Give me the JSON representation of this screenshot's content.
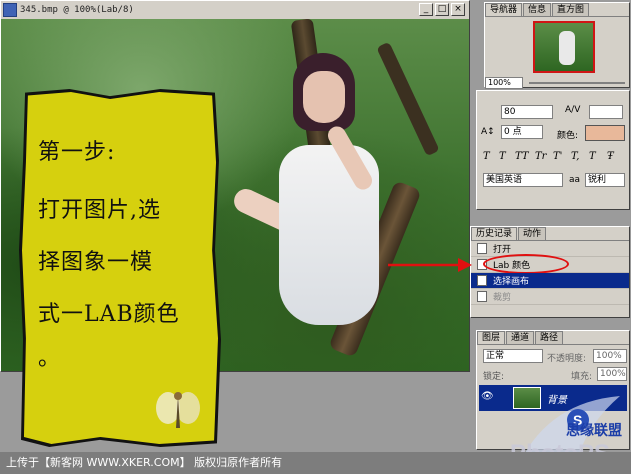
{
  "document": {
    "title": "345.bmp @ 100%(Lab/8)",
    "btn_min": "_",
    "btn_max": "□",
    "btn_close": "×"
  },
  "note": {
    "line1": "第一步:",
    "line2": "打开图片,选",
    "line3": "择图象一模",
    "line4": "式一LAB颜色",
    "line5": "。"
  },
  "navigator": {
    "tabs": [
      "导航器",
      "信息",
      "直方图"
    ],
    "zoom": "100%"
  },
  "character": {
    "size_value": "80",
    "tracking_value": "0 点",
    "color_label": "颜色:",
    "color_swatch": "#e8b89a",
    "language": "美国英语",
    "aa_label": "aa",
    "aa_value": "锐利",
    "style_buttons": [
      "T",
      "T",
      "TT",
      "Tr",
      "T'",
      "T,",
      "T",
      "Ŧ"
    ]
  },
  "history": {
    "tabs": [
      "历史记录",
      "动作"
    ],
    "items": [
      {
        "label": "打开",
        "selected": false
      },
      {
        "label": "Lab 颜色",
        "selected": false
      },
      {
        "label": "选择画布",
        "selected": true
      },
      {
        "label": "裁剪",
        "selected": false
      }
    ]
  },
  "layers": {
    "tabs": [
      "图层",
      "通道",
      "路径"
    ],
    "blend_mode": "正常",
    "opacity_label": "不透明度:",
    "opacity_value": "100%",
    "lock_label": "锁定:",
    "fill_label": "填充:",
    "fill_value": "100%",
    "layer_name": "背景"
  },
  "footer": {
    "text": "上传于【新客网 WWW.XKER.COM】 版权归原作者所有"
  },
  "watermark": {
    "text": "PhotoPS",
    "sub": "思缘联盟"
  },
  "colors": {
    "note_yellow": "#d6d00e",
    "history_selected": "#0a2a8c",
    "arrow_red": "#e01010"
  }
}
